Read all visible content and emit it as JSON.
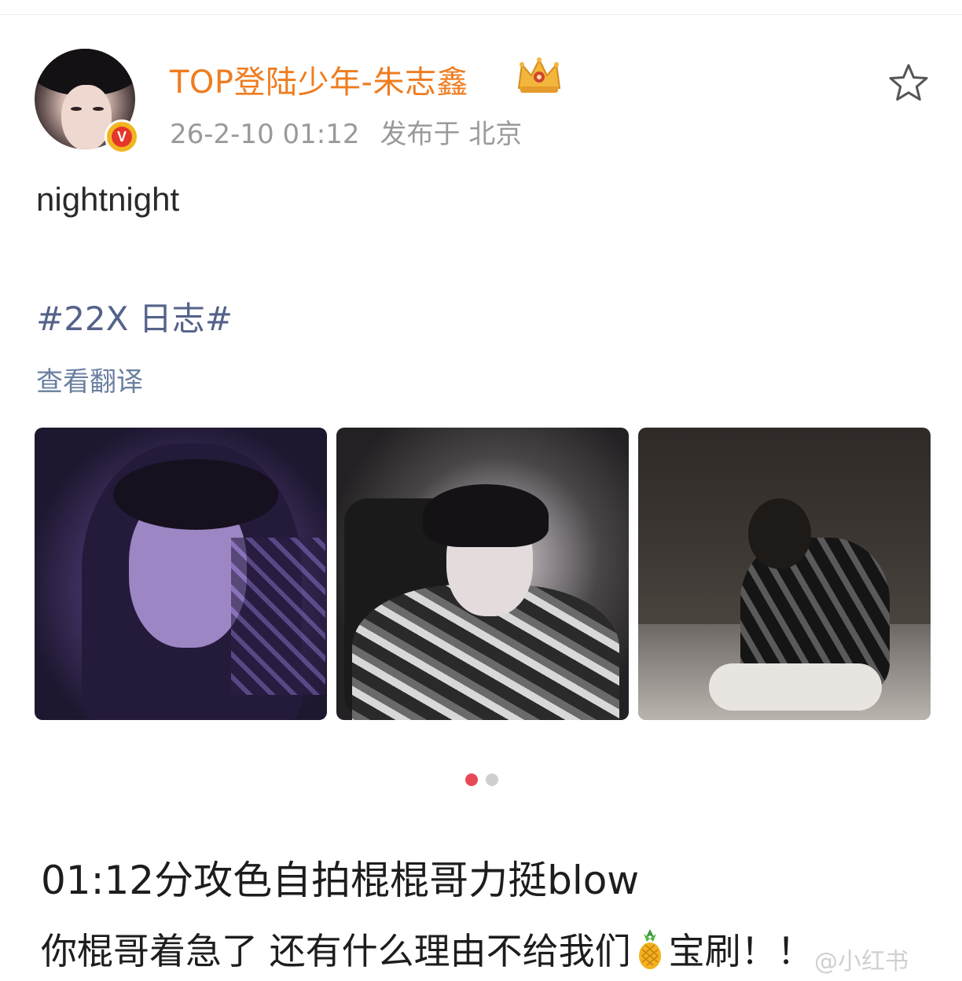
{
  "post": {
    "username": "TOP登陆少年-朱志鑫",
    "timestamp": "26-2-10 01:12",
    "location": "发布于 北京",
    "text": "nightnight",
    "hashtag": "#22X 日志#",
    "translate_link": "查看翻译",
    "icons": {
      "avatar": "avatar",
      "verified": "verified-badge-icon",
      "crown": "crown-icon",
      "favorite": "star-icon"
    },
    "photos": [
      {
        "name": "photo-1"
      },
      {
        "name": "photo-2"
      },
      {
        "name": "photo-3"
      }
    ],
    "pager": {
      "total": 2,
      "active": 0
    }
  },
  "comment": {
    "headline": "01:12分攻色自拍棍棍哥力挺blow",
    "subline_before": "你棍哥着急了 还有什么理由不给我们",
    "subline_after": "宝刷！！",
    "emoji": "pineapple-emoji"
  },
  "watermark": "@小红书",
  "colors": {
    "username": "#f07c1f",
    "hashtag": "#55628a",
    "translate": "#6a7fa0",
    "meta": "#9a9a9a",
    "dot_active": "#e84a55",
    "dot_inactive": "#cfcfcf",
    "verified_outer": "#f1b520",
    "verified_inner": "#e4362a"
  }
}
